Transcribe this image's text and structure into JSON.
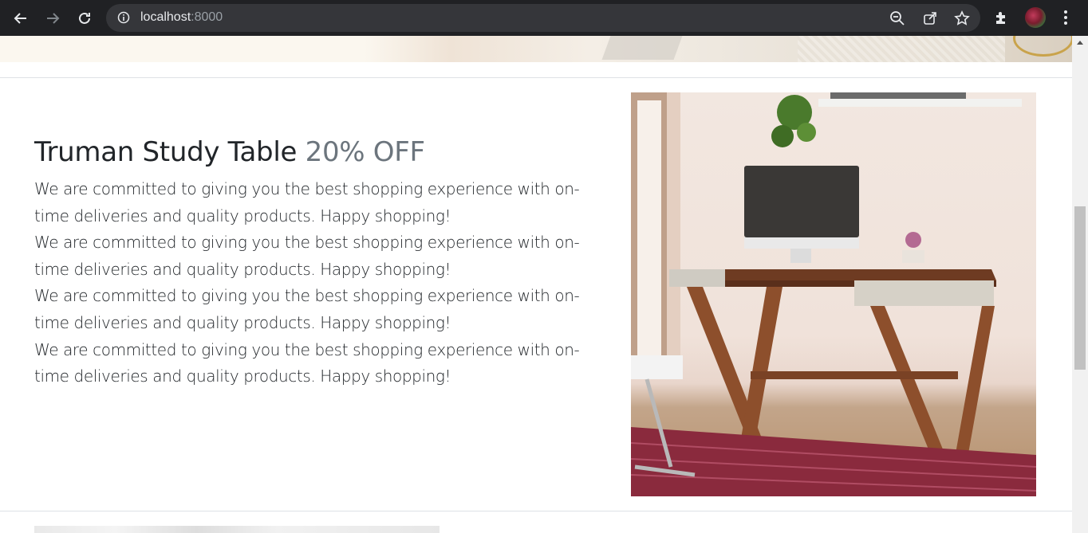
{
  "browser": {
    "url_host": "localhost",
    "url_port": ":8000",
    "icons": [
      "back-icon",
      "forward-icon",
      "reload-icon",
      "info-icon",
      "zoom-out-icon",
      "share-icon",
      "star-icon",
      "extensions-icon",
      "avatar",
      "menu-icon"
    ]
  },
  "product": {
    "title": "Truman Study Table",
    "discount": "20% OFF",
    "paragraphs": [
      "We are committed to giving you the best shopping experience with on- time deliveries and quality products. Happy shopping!",
      "We are committed to giving you the best shopping experience with on- time deliveries and quality products. Happy shopping!",
      "We are committed to giving you the best shopping experience with on- time deliveries and quality products. Happy shopping!",
      "We are committed to giving you the best shopping experience with on- time deliveries and quality products. Happy shopping!"
    ]
  },
  "colors": {
    "chrome_bg": "#202124",
    "heading": "#212529",
    "muted": "#6c757d"
  }
}
